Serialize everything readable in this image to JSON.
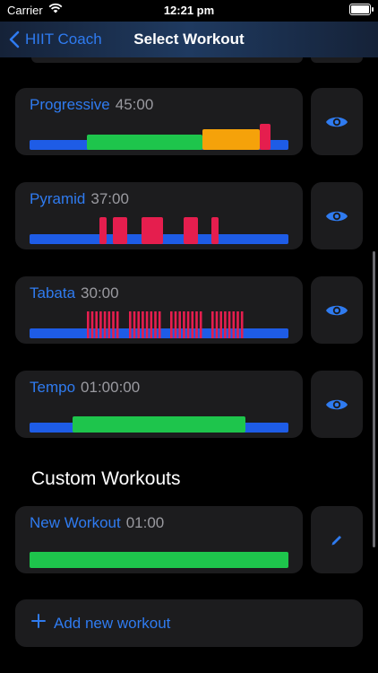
{
  "status": {
    "carrier": "Carrier",
    "time": "12:21 pm"
  },
  "nav": {
    "back_label": "HIIT Coach",
    "title": "Select Workout"
  },
  "colors": {
    "accent": "#2f7bf0",
    "rest": "#1e5ce6",
    "steady": "#1ec54c",
    "moderate": "#f5a20a",
    "high": "#e51e4e"
  },
  "workouts": [
    {
      "name": "Progressive",
      "duration": "45:00",
      "action_icon": "eye-icon"
    },
    {
      "name": "Pyramid",
      "duration": "37:00",
      "action_icon": "eye-icon"
    },
    {
      "name": "Tabata",
      "duration": "30:00",
      "action_icon": "eye-icon"
    },
    {
      "name": "Tempo",
      "duration": "01:00:00",
      "action_icon": "eye-icon"
    }
  ],
  "custom_section_title": "Custom Workouts",
  "custom_workouts": [
    {
      "name": "New Workout",
      "duration": "01:00",
      "action_icon": "pencil-icon"
    }
  ],
  "add_label": "Add new workout"
}
